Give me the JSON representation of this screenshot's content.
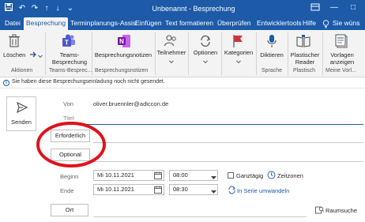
{
  "window": {
    "title": "Unbenannt  -  Besprechung",
    "minimize_glyph": "—",
    "restore_glyph": "□"
  },
  "quick_access": {
    "undo_glyph": "↶",
    "redo_glyph": "↷",
    "up_glyph": "↑",
    "down_glyph": "↓",
    "more_glyph": "⌄"
  },
  "tabs": [
    "Datei",
    "Besprechung",
    "Terminplanungs-Assis",
    "Einfügen",
    "Text formatieren",
    "Überprüfen",
    "Entwicklertools",
    "Hilfe"
  ],
  "tell_me": "Sie wüns",
  "ribbon": {
    "delete_label": "Löschen",
    "teams_label_line1": "Teams-",
    "teams_label_line2": "Besprechung",
    "notes_label": "Besprechungsnotizen",
    "attendees_label": "Teilnehmer",
    "options_label": "Optionen",
    "categories_label": "Kategorien",
    "dictate_label": "Diktieren",
    "reader_label_line1": "Plastischer",
    "reader_label_line2": "Reader",
    "templates_label_line1": "Vorlagen",
    "templates_label_line2": "anzeigen",
    "groups": {
      "actions": "Aktionen",
      "teams": "Teams-Besprec...",
      "notes": "Besprechungsnotizen",
      "speech": "Sprache",
      "immersive": "Plastisch",
      "templates": "Meine Vorl..."
    }
  },
  "info_message": "Sie haben diese Besprechungseinladung noch nicht gesendet.",
  "form": {
    "send_label": "Senden",
    "from_label": "Von",
    "from_value": "oliver.bruennler@adiccon.de",
    "title_placeholder": "Titel",
    "required_button": "Erforderlich",
    "optional_button": "Optional",
    "start_label": "Beginn",
    "end_label": "Ende",
    "start_date": "Mi 10.11.2021",
    "start_time": "08:00",
    "end_date": "Mi 10.11.2021",
    "end_time": "08:30",
    "all_day_label": "Ganztägig",
    "timezones_label": "Zeitzonen",
    "recurrence_label": "In Serie umwandeln",
    "location_button": "Ort",
    "room_finder_label": "Raumsuche"
  },
  "colors": {
    "brand_blue": "#1d5aa8",
    "annotation_red": "#e0121b",
    "teams_purple": "#5059c9",
    "onenote_purple": "#7719aa",
    "category_red": "#d13438"
  }
}
